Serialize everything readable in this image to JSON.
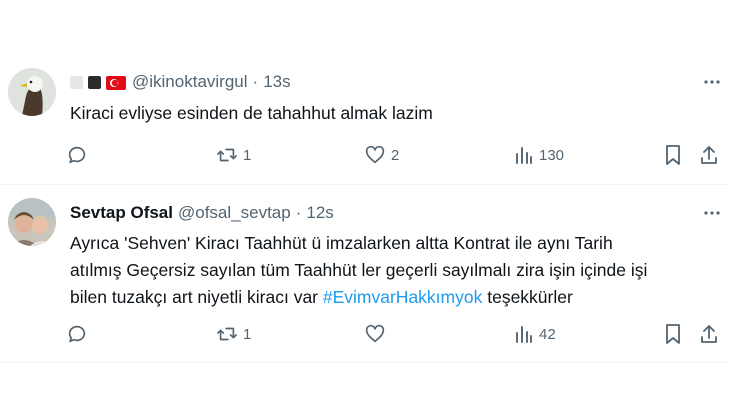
{
  "tweets": [
    {
      "handle": "@ikinoktavirgul",
      "time": "13s",
      "text": "Kiraci evliyse esinden de tahahhut almak lazim",
      "flag_colors": [
        "#e6e6e6",
        "#2b2b2b",
        "#e30a17"
      ],
      "actions": {
        "reply": "",
        "retweet": "1",
        "like": "2",
        "views": "130"
      }
    },
    {
      "name": "Sevtap Ofsal",
      "handle": "@ofsal_sevtap",
      "time": "12s",
      "text_parts": {
        "line1": "Ayrıca 'Sehven' Kiracı Taahhüt ü imzalarken altta Kontrat ile aynı Tarih",
        "line2": "atılmış Geçersiz sayılan tüm Taahhüt ler geçerli sayılmalı zira işin içinde işi",
        "line3_before": "bilen tuzakçı art niyetli kiracı var ",
        "hashtag": "#EvimvarHakkımyok",
        "line3_after": " teşekkürler"
      },
      "actions": {
        "reply": "",
        "retweet": "1",
        "like": "",
        "views": "42"
      }
    }
  ],
  "colors": {
    "text": "#0f1419",
    "secondary": "#536471",
    "link": "#1d9bf0",
    "divider": "#eff3f4"
  }
}
